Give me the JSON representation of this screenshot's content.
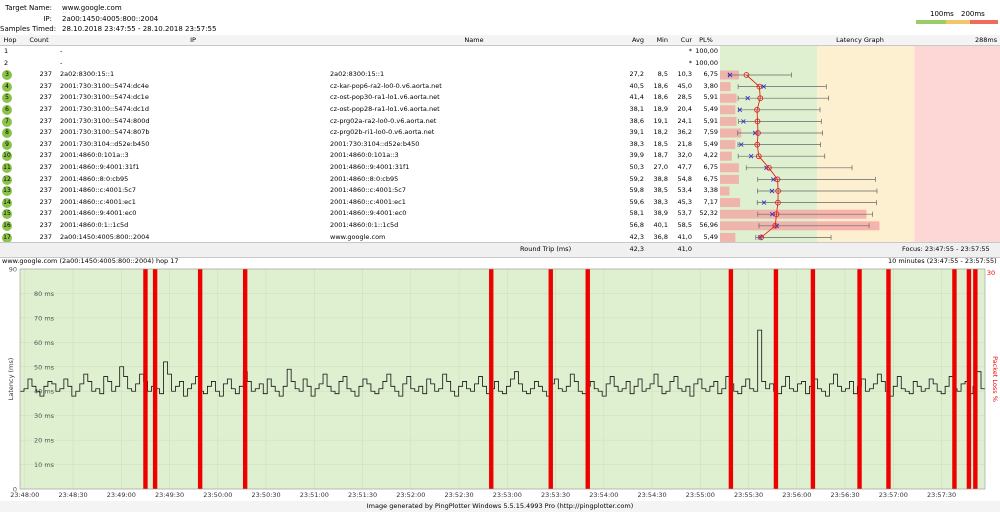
{
  "header": {
    "target_label": "Target Name:",
    "target_value": "www.google.com",
    "ip_label": "IP:",
    "ip_value": "2a00:1450:4005:800::2004",
    "samples_label": "Samples Timed:",
    "samples_value": "28.10.2018 23:47:55 - 28.10.2018 23:57:55",
    "legend_100": "100ms",
    "legend_200": "200ms"
  },
  "colors": {
    "green_zone": "#dff0d0",
    "yellow_zone": "#fdf0d0",
    "red_zone": "#fdd6d6",
    "loss_red": "#ee0000",
    "hop_ball": "#8bc34a"
  },
  "columns": {
    "hop": "Hop",
    "count": "Count",
    "ip": "IP",
    "name": "Name",
    "avg": "Avg",
    "min": "Min",
    "cur": "Cur",
    "pl": "PL%",
    "latency_graph": "Latency Graph",
    "max_ms": "288ms"
  },
  "hops": [
    {
      "hop": "1",
      "count": "",
      "ip": "-",
      "name": "",
      "avg": "",
      "min": "",
      "cur": "*",
      "pl": "100,00",
      "ball": false
    },
    {
      "hop": "2",
      "count": "",
      "ip": "-",
      "name": "",
      "avg": "",
      "min": "",
      "cur": "*",
      "pl": "100,00",
      "ball": false
    },
    {
      "hop": "3",
      "count": "237",
      "ip": "2a02:8300:15::1",
      "name": "2a02:8300:15::1",
      "avg": "27,2",
      "min": "8,5",
      "cur": "10,3",
      "pl": "6,75",
      "ball": true
    },
    {
      "hop": "4",
      "count": "237",
      "ip": "2001:730:3100::5474:dc4e",
      "name": "cz-kar-pop6-ra2-lo0-0.v6.aorta.net",
      "avg": "40,5",
      "min": "18,6",
      "cur": "45,0",
      "pl": "3,80",
      "ball": true
    },
    {
      "hop": "5",
      "count": "237",
      "ip": "2001:730:3100::5474:dc1e",
      "name": "cz-ost-pop30-ra1-lo1.v6.aorta.net",
      "avg": "41,4",
      "min": "18,6",
      "cur": "28,5",
      "pl": "5,91",
      "ball": true
    },
    {
      "hop": "6",
      "count": "237",
      "ip": "2001:730:3100::5474:dc1d",
      "name": "cz-ost-pop28-ra1-lo1.v6.aorta.net",
      "avg": "38,1",
      "min": "18,9",
      "cur": "20,4",
      "pl": "5,49",
      "ball": true
    },
    {
      "hop": "7",
      "count": "237",
      "ip": "2001:730:3100::5474:800d",
      "name": "cz-prg02a-ra2-lo0-0.v6.aorta.net",
      "avg": "38,6",
      "min": "19,1",
      "cur": "24,1",
      "pl": "5,91",
      "ball": true
    },
    {
      "hop": "8",
      "count": "237",
      "ip": "2001:730:3100::5474:807b",
      "name": "cz-prg02b-ri1-lo0-0.v6.aorta.net",
      "avg": "39,1",
      "min": "18,2",
      "cur": "36,2",
      "pl": "7,59",
      "ball": true
    },
    {
      "hop": "9",
      "count": "237",
      "ip": "2001:730:3104::d52e:b450",
      "name": "2001:730:3104::d52e:b450",
      "avg": "38,3",
      "min": "18,5",
      "cur": "21,8",
      "pl": "5,49",
      "ball": true
    },
    {
      "hop": "10",
      "count": "237",
      "ip": "2001:4860:0:101a::3",
      "name": "2001:4860:0:101a::3",
      "avg": "39,9",
      "min": "18,7",
      "cur": "32,0",
      "pl": "4,22",
      "ball": true
    },
    {
      "hop": "11",
      "count": "237",
      "ip": "2001:4860::9:4001:31f1",
      "name": "2001:4860::9:4001:31f1",
      "avg": "50,3",
      "min": "27,0",
      "cur": "47,7",
      "pl": "6,75",
      "ball": true
    },
    {
      "hop": "12",
      "count": "237",
      "ip": "2001:4860::8:0:cb95",
      "name": "2001:4860::8:0:cb95",
      "avg": "59,2",
      "min": "38,8",
      "cur": "54,8",
      "pl": "6,75",
      "ball": true
    },
    {
      "hop": "13",
      "count": "237",
      "ip": "2001:4860::c:4001:5c7",
      "name": "2001:4860::c:4001:5c7",
      "avg": "59,8",
      "min": "38,5",
      "cur": "53,4",
      "pl": "3,38",
      "ball": true
    },
    {
      "hop": "14",
      "count": "237",
      "ip": "2001:4860::c:4001:ec1",
      "name": "2001:4860::c:4001:ec1",
      "avg": "59,6",
      "min": "38,3",
      "cur": "45,3",
      "pl": "7,17",
      "ball": true
    },
    {
      "hop": "15",
      "count": "237",
      "ip": "2001:4860::9:4001:ec0",
      "name": "2001:4860::9:4001:ec0",
      "avg": "58,1",
      "min": "38,9",
      "cur": "53,7",
      "pl": "52,32",
      "ball": true
    },
    {
      "hop": "16",
      "count": "237",
      "ip": "2001:4860:0:1::1c5d",
      "name": "2001:4860:0:1::1c5d",
      "avg": "56,8",
      "min": "40,1",
      "cur": "58,5",
      "pl": "56,96",
      "ball": true
    },
    {
      "hop": "17",
      "count": "237",
      "ip": "2a00:1450:4005:800::2004",
      "name": "www.google.com",
      "avg": "42,3",
      "min": "36,8",
      "cur": "41,0",
      "pl": "5,49",
      "ball": true
    }
  ],
  "roundtrip": {
    "label": "Round Trip (ms)",
    "avg": "42,3",
    "cur": "41,0",
    "focus": "Focus: 23:47:55 - 23:57:55"
  },
  "graph": {
    "title": "www.google.com (2a00:1450:4005:800::2004) hop 17",
    "range": "10 minutes (23:47:55 - 23:57:55)",
    "right_max": "30",
    "ylabel": "Latency (ms)",
    "y2label": "Packet Loss %"
  },
  "footer": "Image generated by PingPlotter Windows 5.5.15.4993 Pro (http://pingplotter.com)",
  "chart_data": {
    "type": "line",
    "title": "www.google.com (2a00:1450:4005:800::2004) hop 17",
    "ylabel": "Latency (ms)",
    "y2label": "Packet Loss %",
    "ylim": [
      0,
      90
    ],
    "y2max": 30,
    "y_ticks": [
      "90",
      "80 ms",
      "70 ms",
      "60 ms",
      "50 ms",
      "40 ms",
      "30 ms",
      "20 ms",
      "10 ms",
      "0"
    ],
    "x_ticks": [
      "23:48:00",
      "23:48:30",
      "23:49:00",
      "23:49:30",
      "23:50:00",
      "23:50:30",
      "23:51:00",
      "23:51:30",
      "23:52:00",
      "23:52:30",
      "23:53:00",
      "23:53:30",
      "23:54:00",
      "23:54:30",
      "23:55:00",
      "23:55:30",
      "23:56:00",
      "23:56:30",
      "23:57:00",
      "23:57:30"
    ],
    "loss_times_sec": [
      75,
      81,
      109,
      137,
      290,
      327,
      350,
      439,
      467,
      490,
      519,
      537,
      578,
      587,
      591
    ],
    "latency": [
      40,
      41,
      45,
      42,
      40,
      38,
      42,
      44,
      43,
      40,
      41,
      45,
      42,
      38,
      40,
      43,
      47,
      44,
      40,
      41,
      39,
      46,
      44,
      40,
      42,
      50,
      46,
      41,
      40,
      43,
      47,
      44,
      40,
      42,
      41,
      39,
      52,
      47,
      40,
      42,
      44,
      38,
      41,
      43,
      46,
      40,
      39,
      42,
      44,
      40,
      38,
      43,
      45,
      41,
      39,
      42,
      48,
      44,
      40,
      41,
      43,
      39,
      45,
      42,
      40,
      38,
      42,
      49,
      44,
      41,
      40,
      45,
      42,
      38,
      41,
      43,
      47,
      42,
      40,
      39,
      44,
      46,
      41,
      40,
      38,
      42,
      45,
      43,
      40,
      39,
      41,
      44,
      47,
      42,
      40,
      38,
      43,
      46,
      41,
      40,
      42,
      39,
      45,
      43,
      40,
      41,
      47,
      44,
      40,
      38,
      42,
      44,
      41,
      40,
      43,
      46,
      42,
      39,
      41,
      44,
      40,
      39,
      42,
      45,
      48,
      43,
      40,
      39,
      41,
      44,
      42,
      40,
      38,
      43,
      45,
      41,
      40,
      42,
      47,
      44,
      40,
      39,
      42,
      44,
      41,
      40,
      38,
      43,
      46,
      42,
      40,
      41,
      44,
      39,
      42,
      45,
      40,
      41,
      43,
      47,
      42,
      39,
      40,
      44,
      46,
      41,
      40,
      42,
      38,
      43,
      45,
      41,
      40,
      42,
      44,
      39,
      41,
      46,
      43,
      40,
      39,
      42,
      45,
      41,
      40,
      65,
      44,
      41,
      43,
      40,
      39,
      42,
      46,
      41,
      40,
      43,
      44,
      39,
      42,
      45,
      41,
      40,
      38,
      43,
      47,
      42,
      40,
      41,
      44,
      39,
      42,
      45,
      40,
      41,
      43,
      47,
      44,
      40,
      38,
      42,
      46,
      41,
      40,
      39,
      44,
      42,
      40,
      41,
      45,
      43,
      40,
      39,
      42,
      46,
      41,
      40,
      43,
      44,
      39,
      42,
      48,
      41
    ]
  }
}
